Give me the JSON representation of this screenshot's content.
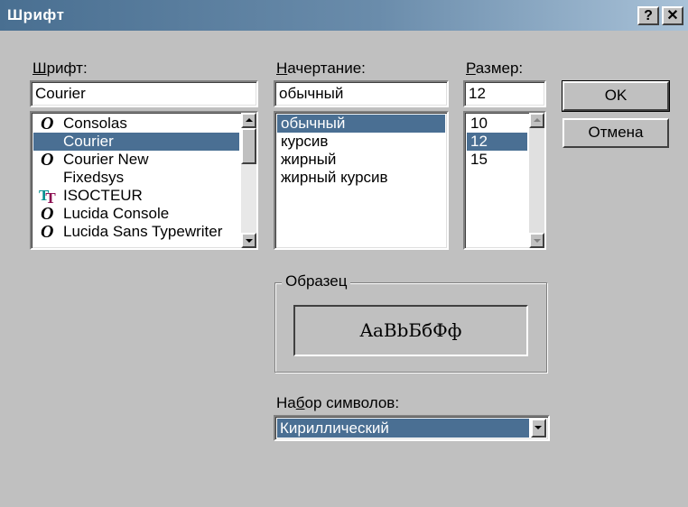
{
  "window": {
    "title": "Шрифт",
    "help_label": "?",
    "close_label": "✕"
  },
  "font": {
    "label": "Шрифт:",
    "label_rest": "рифт:",
    "label_first": "Ш",
    "value": "Courier",
    "items": [
      {
        "label": "Consolas",
        "icon": "opentype-icon"
      },
      {
        "label": "Courier",
        "icon": ""
      },
      {
        "label": "Courier New",
        "icon": "opentype-icon"
      },
      {
        "label": "Fixedsys",
        "icon": ""
      },
      {
        "label": "ISOCTEUR",
        "icon": "truetype-icon"
      },
      {
        "label": "Lucida Console",
        "icon": "opentype-icon"
      },
      {
        "label": "Lucida Sans Typewriter",
        "icon": "opentype-icon"
      }
    ],
    "selected": "Courier"
  },
  "style": {
    "label_first": "Н",
    "label_rest": "ачертание:",
    "value": "обычный",
    "items": [
      "обычный",
      "курсив",
      "жирный",
      "жирный курсив"
    ],
    "selected": "обычный"
  },
  "size": {
    "label_first": "Р",
    "label_rest": "азмер:",
    "value": "12",
    "items": [
      "10",
      "12",
      "15"
    ],
    "selected": "12"
  },
  "buttons": {
    "ok": "OK",
    "cancel": "Отмена"
  },
  "sample": {
    "legend": "Образец",
    "text": "AaBbБбФф"
  },
  "charset": {
    "label_a": "На",
    "label_u": "б",
    "label_b": "ор символов:",
    "value": "Кириллический"
  },
  "colors": {
    "selection": "#4a6f93",
    "face": "#c0c0c0"
  }
}
